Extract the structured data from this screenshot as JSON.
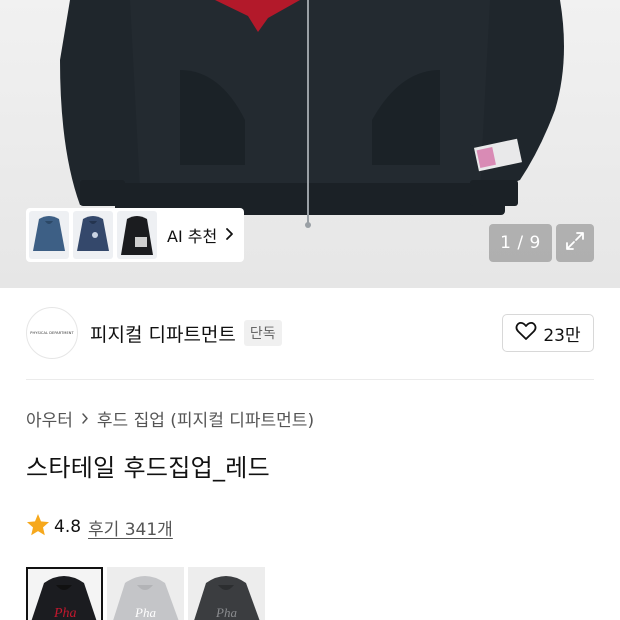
{
  "gallery": {
    "counter": "1 / 9",
    "ai_recommend_label": "AI 추천",
    "thumbnails": [
      "denim-hoodie-thumbnail",
      "blue-hoodie-thumbnail",
      "black-hoodie-thumbnail"
    ]
  },
  "brand": {
    "logo_text": "PHYSICAL DEPARTMENT",
    "name": "피지컬 디파트먼트",
    "badge": "단독",
    "likes": "23만"
  },
  "product": {
    "breadcrumb": [
      "아우터",
      "후드 집업 (피지컬 디파트먼트)"
    ],
    "title": "스타테일 후드집업_레드",
    "rating": "4.8",
    "reviews": "후기 341개"
  },
  "colors": {
    "star": "#f6a81c",
    "hoodie_body": "#1e252b",
    "accent_red": "#b3192a"
  },
  "options": [
    "red-option",
    "gray-option",
    "charcoal-option"
  ]
}
